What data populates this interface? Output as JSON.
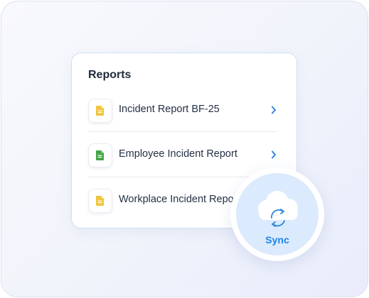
{
  "reports": {
    "title": "Reports",
    "items": [
      {
        "label": "Incident Report BF-25",
        "icon": "document-icon",
        "icon_color": "#f0c43c",
        "has_chevron": true
      },
      {
        "label": "Employee Incident Report",
        "icon": "document-icon",
        "icon_color": "#45a546",
        "has_chevron": true
      },
      {
        "label": "Workplace Incident Report",
        "icon": "document-icon",
        "icon_color": "#f0c43c",
        "has_chevron": false
      }
    ]
  },
  "sync": {
    "label": "Sync",
    "icon": "cloud-sync-icon",
    "accent_color": "#1f83e8"
  }
}
